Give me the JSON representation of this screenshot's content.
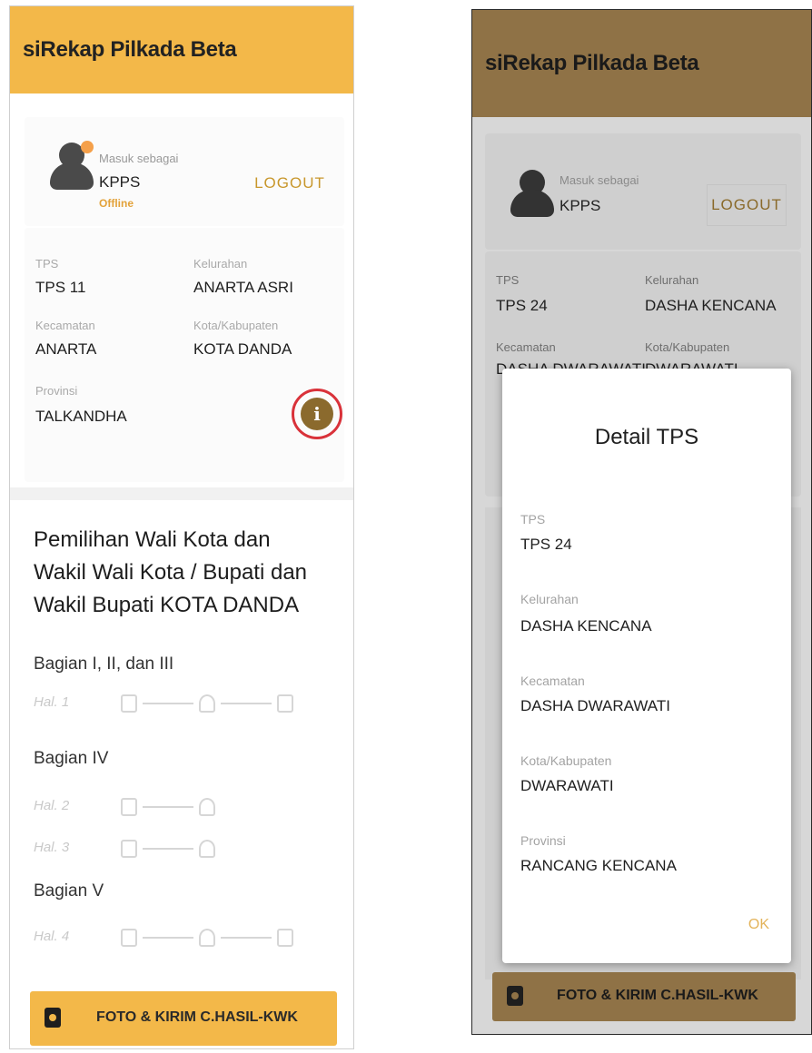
{
  "app": {
    "title": "siRekap Pilkada Beta"
  },
  "left_screen": {
    "login": {
      "caption": "Masuk sebagai",
      "role": "KPPS",
      "status": "Offline",
      "logout_label": "LOGOUT"
    },
    "fields": {
      "tps_label": "TPS",
      "tps_value": "TPS 11",
      "kelurahan_label": "Kelurahan",
      "kelurahan_value": "ANARTA ASRI",
      "kecamatan_label": "Kecamatan",
      "kecamatan_value": "ANARTA",
      "kota_label": "Kota/Kabupaten",
      "kota_value": "KOTA DANDA",
      "provinsi_label": "Provinsi",
      "provinsi_value": "TALKANDHA"
    },
    "info_icon": "info-icon",
    "election_title": "Pemilihan Wali Kota dan Wakil Wali Kota / Bupati dan Wakil Bupati KOTA DANDA",
    "sections": [
      {
        "title": "Bagian I, II, dan III",
        "pages": [
          {
            "label": "Hal. 1"
          }
        ]
      },
      {
        "title": "Bagian IV",
        "pages": [
          {
            "label": "Hal. 2"
          },
          {
            "label": "Hal. 3"
          }
        ]
      },
      {
        "title": "Bagian V",
        "pages": [
          {
            "label": "Hal. 4"
          }
        ]
      }
    ],
    "primary_action_label": "FOTO & KIRIM C.HASIL-KWK"
  },
  "right_screen": {
    "login": {
      "caption": "Masuk sebagai",
      "role": "KPPS",
      "logout_label": "LOGOUT"
    },
    "fields": {
      "tps_label": "TPS",
      "tps_value": "TPS 24",
      "kelurahan_label": "Kelurahan",
      "kelurahan_value": "DASHA KENCANA",
      "kecamatan_label": "Kecamatan",
      "kecamatan_value": "DASHA DWARAWATI",
      "kota_label": "Kota/Kabupaten",
      "kota_value": "DWARAWATI"
    },
    "dialog": {
      "title": "Detail TPS",
      "tps_label": "TPS",
      "tps_value": "TPS 24",
      "kelurahan_label": "Kelurahan",
      "kelurahan_value": "DASHA KENCANA",
      "kecamatan_label": "Kecamatan",
      "kecamatan_value": "DASHA DWARAWATI",
      "kota_label": "Kota/Kabupaten",
      "kota_value": "DWARAWATI",
      "provinsi_label": "Provinsi",
      "provinsi_value": "RANCANG KENCANA",
      "ok_label": "OK"
    },
    "primary_action_label": "FOTO & KIRIM C.HASIL-KWK"
  },
  "colors": {
    "accent": "#f3b849",
    "accent_dimmed": "#8f7246",
    "highlight_ring": "#d9323a",
    "info_icon": "#8b6a2d"
  }
}
